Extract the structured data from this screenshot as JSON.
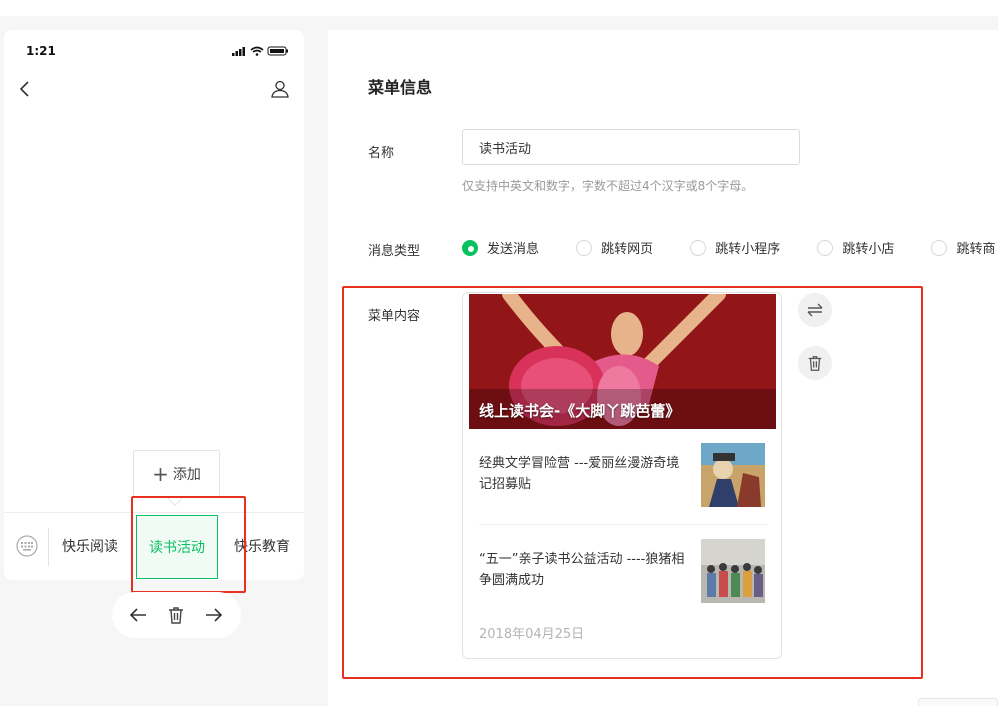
{
  "phone": {
    "status_time": "1:21",
    "menu_items": [
      "快乐阅读",
      "读书活动",
      "快乐教育"
    ],
    "active_index": 1,
    "add_label": "添加"
  },
  "panel": {
    "title": "菜单信息",
    "name_label": "名称",
    "name_value": "读书活动",
    "name_hint": "仅支持中英文和数字，字数不超过4个汉字或8个字母。",
    "type_label": "消息类型",
    "radio_options": [
      "发送消息",
      "跳转网页",
      "跳转小程序",
      "跳转小店",
      "跳转商"
    ],
    "selected_option": "发送消息",
    "content_label": "菜单内容"
  },
  "card": {
    "cover_title": "线上读书会-《大脚丫跳芭蕾》",
    "articles": [
      {
        "title": "经典文学冒险营 ---爱丽丝漫游奇境记招募贴"
      },
      {
        "title": "“五一”亲子读书公益活动 ----狼猪相争圆满成功"
      }
    ],
    "date": "2018年04月25日"
  },
  "colors": {
    "accent": "#07c160",
    "highlight": "#e7301f"
  }
}
